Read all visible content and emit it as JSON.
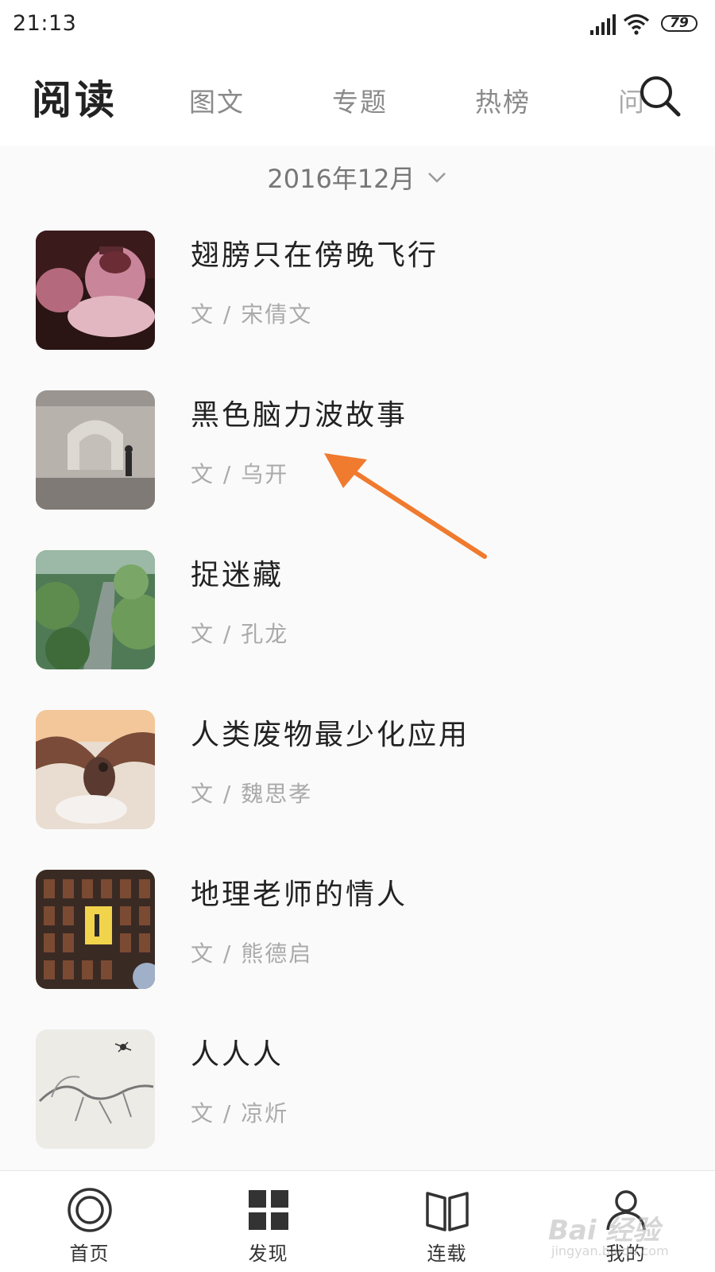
{
  "status_bar": {
    "time": "21:13",
    "battery": "79",
    "signal_icon": "signal-icon",
    "wifi_icon": "wifi-icon"
  },
  "header": {
    "title": "阅读",
    "tabs": [
      {
        "label": "图文"
      },
      {
        "label": "专题"
      },
      {
        "label": "热榜"
      },
      {
        "label": "问"
      }
    ],
    "search_icon": "search-icon"
  },
  "month_selector": {
    "label": "2016年12月",
    "icon": "chevron-down-icon"
  },
  "articles": [
    {
      "title": "翅膀只在傍晚飞行",
      "author": "文 / 宋倩文"
    },
    {
      "title": "黑色脑力波故事",
      "author": "文 / 乌开"
    },
    {
      "title": "捉迷藏",
      "author": "文 / 孔龙"
    },
    {
      "title": "人类废物最少化应用",
      "author": "文 / 魏思孝"
    },
    {
      "title": "地理老师的情人",
      "author": "文 / 熊德启"
    },
    {
      "title": "人人人",
      "author": "文 / 凉炘"
    }
  ],
  "annotation": {
    "color": "#f07a2e"
  },
  "bottom_nav": [
    {
      "label": "首页",
      "icon": "home-circle-icon"
    },
    {
      "label": "发现",
      "icon": "grid-icon"
    },
    {
      "label": "连载",
      "icon": "book-icon"
    },
    {
      "label": "我的",
      "icon": "person-icon"
    }
  ],
  "watermark": {
    "main": "Bai 经验",
    "sub": "jingyan.baidu.com"
  }
}
